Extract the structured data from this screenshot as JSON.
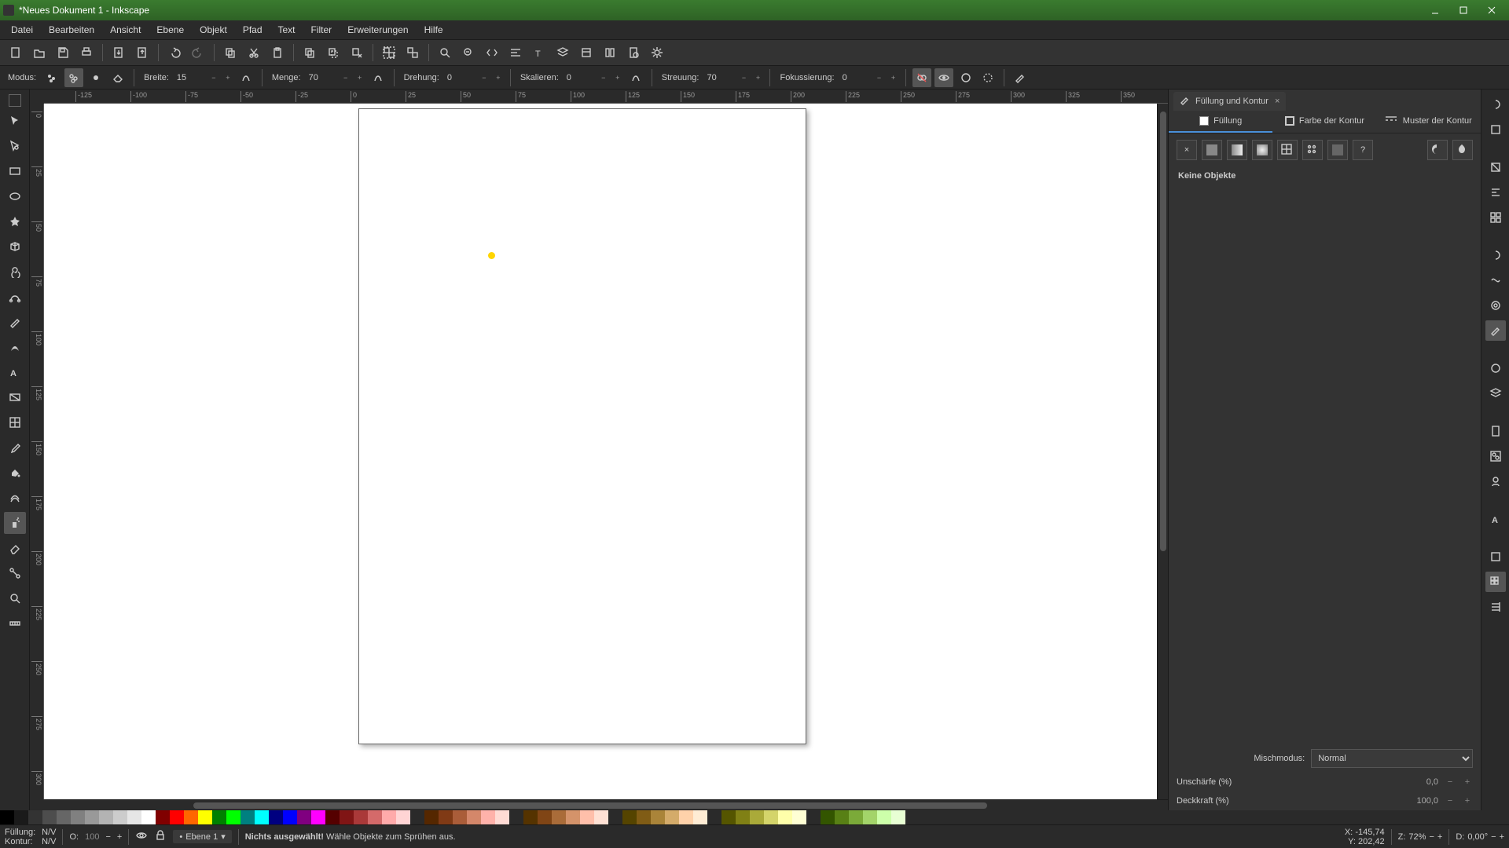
{
  "window": {
    "title": "*Neues Dokument 1 - Inkscape"
  },
  "menu": [
    "Datei",
    "Bearbeiten",
    "Ansicht",
    "Ebene",
    "Objekt",
    "Pfad",
    "Text",
    "Filter",
    "Erweiterungen",
    "Hilfe"
  ],
  "optbar": {
    "modus_label": "Modus:",
    "breite_label": "Breite:",
    "breite_val": "15",
    "menge_label": "Menge:",
    "menge_val": "70",
    "drehung_label": "Drehung:",
    "drehung_val": "0",
    "skalieren_label": "Skalieren:",
    "skalieren_val": "0",
    "streuung_label": "Streuung:",
    "streuung_val": "70",
    "fokus_label": "Fokussierung:",
    "fokus_val": "0"
  },
  "ruler_h": [
    "-125",
    "-100",
    "-75",
    "-50",
    "-25",
    "0",
    "25",
    "50",
    "75",
    "100",
    "125",
    "150",
    "175",
    "200",
    "225",
    "250",
    "275",
    "300",
    "325",
    "350"
  ],
  "ruler_v": [
    "0",
    "25",
    "50",
    "75",
    "100",
    "125",
    "150",
    "175",
    "200",
    "225",
    "250",
    "275",
    "300"
  ],
  "panel": {
    "dock_title": "Füllung und Kontur",
    "tab_fill": "Füllung",
    "tab_stroke": "Farbe der Kontur",
    "tab_pattern": "Muster der Kontur",
    "no_objects": "Keine Objekte",
    "blend_label": "Mischmodus:",
    "blend_value": "Normal",
    "blur_label": "Unschärfe (%)",
    "blur_value": "0,0",
    "opacity_label": "Deckkraft (%)",
    "opacity_value": "100,0"
  },
  "palette_grays": [
    "#000000",
    "#1a1a1a",
    "#333333",
    "#4d4d4d",
    "#666666",
    "#808080",
    "#999999",
    "#b3b3b3",
    "#cccccc",
    "#e6e6e6",
    "#ffffff"
  ],
  "palette_base": [
    "#800000",
    "#ff0000",
    "#ff6600",
    "#ffff00",
    "#008000",
    "#00ff00",
    "#008080",
    "#00ffff",
    "#000080",
    "#0000ff",
    "#800080",
    "#ff00ff"
  ],
  "palette_reds": [
    "#550000",
    "#801515",
    "#aa3939",
    "#d46a6a",
    "#ffaaaa",
    "#ffd4d4"
  ],
  "palette_maroons": [
    "#552700",
    "#803a15",
    "#aa5d39",
    "#d4876a",
    "#ffb2aa",
    "#ffdbd4"
  ],
  "palette_browns": [
    "#553300",
    "#804515",
    "#aa6c39",
    "#d4936a",
    "#ffbfaa",
    "#ffe1d4"
  ],
  "palette_tans": [
    "#554400",
    "#805c15",
    "#aa8439",
    "#d4ab6a",
    "#ffd2aa",
    "#ffecd4"
  ],
  "palette_dkyel": [
    "#555500",
    "#808015",
    "#aaaa39",
    "#d4d46a",
    "#ffffaa",
    "#ffffd4"
  ],
  "palette_yellows": [
    "#335500",
    "#588015",
    "#7baa39",
    "#a3d46a",
    "#cdffaa",
    "#e8ffd4"
  ],
  "status": {
    "fill_label": "Füllung:",
    "stroke_label": "Kontur:",
    "fill_value": "N/V",
    "stroke_value": "N/V",
    "o_label": "O:",
    "o_value": "100",
    "layer": "Ebene 1",
    "msg_bold": "Nichts ausgewählt!",
    "msg_rest": " Wähle Objekte zum Sprühen aus.",
    "x_label": "X:",
    "y_label": "Y:",
    "x_val": "-145,74",
    "y_val": "202,42",
    "z_label": "Z:",
    "z_val": "72%",
    "d_label": "D:",
    "d_val": "0,00°"
  }
}
